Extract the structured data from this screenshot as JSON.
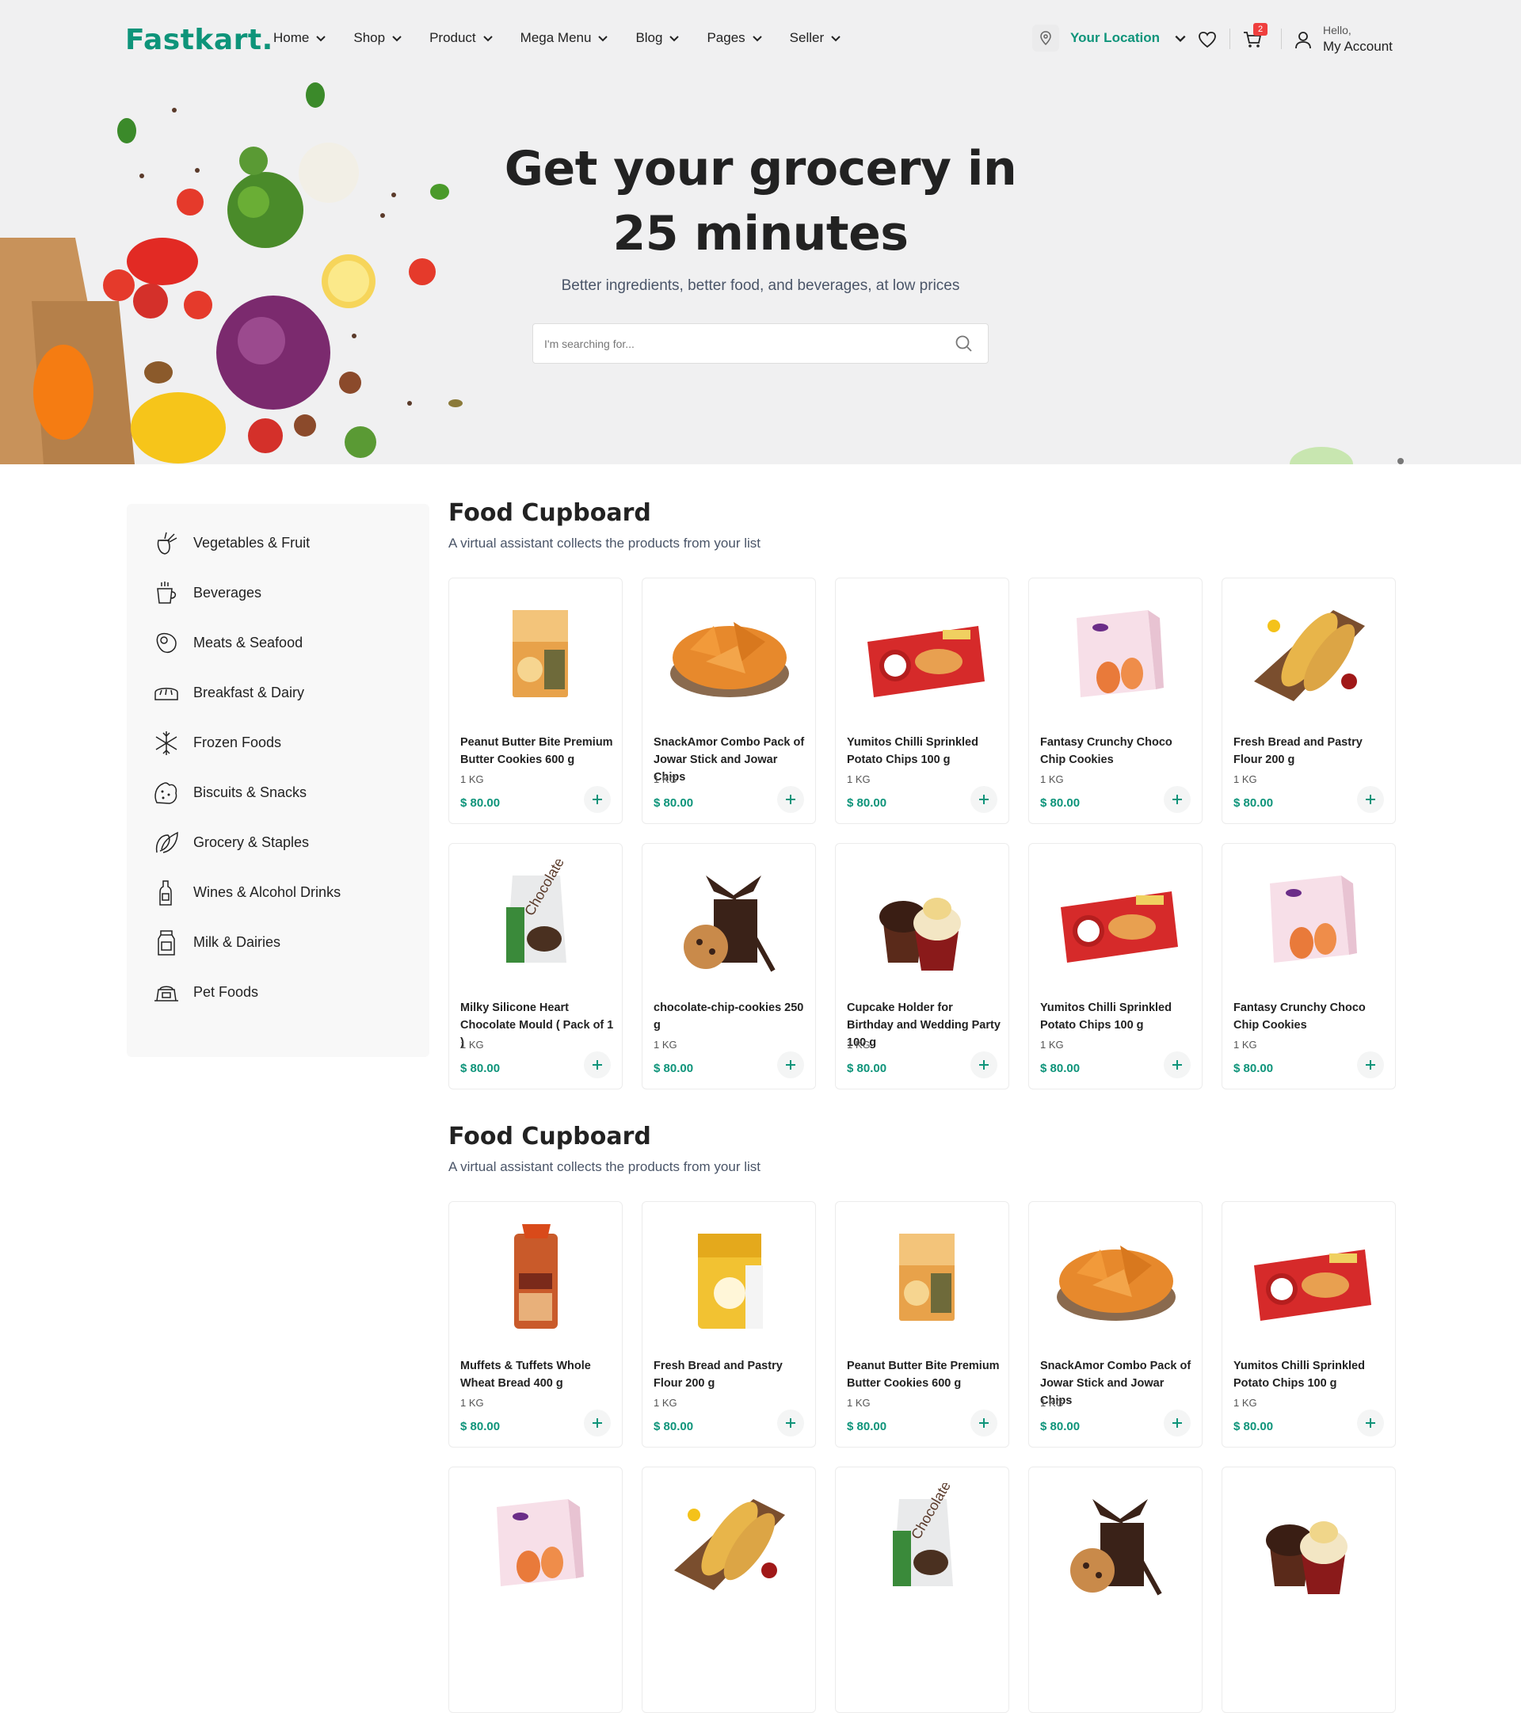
{
  "header": {
    "logo_main": "Fastkart",
    "logo_dot": ".",
    "nav": [
      "Home",
      "Shop",
      "Product",
      "Mega Menu",
      "Blog",
      "Pages",
      "Seller"
    ],
    "location_label": "Your Location",
    "cart_count": "2",
    "account_greeting": "Hello,",
    "account_label": "My Account"
  },
  "hero": {
    "title": "Get your grocery in 25 minutes",
    "subtitle": "Better ingredients, better food, and beverages, at low prices",
    "search_placeholder": "I'm searching for..."
  },
  "categories": [
    {
      "label": "Vegetables & Fruit",
      "icon": "vegetables-icon"
    },
    {
      "label": "Beverages",
      "icon": "cup-icon"
    },
    {
      "label": "Meats & Seafood",
      "icon": "meat-icon"
    },
    {
      "label": "Breakfast & Dairy",
      "icon": "bread-icon"
    },
    {
      "label": "Frozen Foods",
      "icon": "snowflake-icon"
    },
    {
      "label": "Biscuits & Snacks",
      "icon": "biscuit-icon"
    },
    {
      "label": "Grocery & Staples",
      "icon": "leaf-icon"
    },
    {
      "label": "Wines & Alcohol Drinks",
      "icon": "wine-bottle-icon"
    },
    {
      "label": "Milk & Dairies",
      "icon": "milk-icon"
    },
    {
      "label": "Pet Foods",
      "icon": "pet-food-icon"
    }
  ],
  "sections": [
    {
      "title": "Food Cupboard",
      "subtitle": "A virtual assistant collects the products from your list",
      "products": [
        {
          "name": "Peanut Butter Bite Premium Butter Cookies 600 g",
          "unit": "1 KG",
          "price": "$ 80.00",
          "image": "cookie-box"
        },
        {
          "name": "SnackAmor Combo Pack of Jowar Stick and Jowar Chips",
          "unit": "1 KG",
          "price": "$ 80.00",
          "image": "chips-bowl"
        },
        {
          "name": "Yumitos Chilli Sprinkled Potato Chips 100 g",
          "unit": "1 KG",
          "price": "$ 80.00",
          "image": "croissant-pack"
        },
        {
          "name": "Fantasy Crunchy Choco Chip Cookies",
          "unit": "1 KG",
          "price": "$ 80.00",
          "image": "pink-box"
        },
        {
          "name": "Fresh Bread and Pastry Flour 200 g",
          "unit": "1 KG",
          "price": "$ 80.00",
          "image": "baguette-board"
        },
        {
          "name": "Milky Silicone Heart Chocolate Mould ( Pack of 1 )",
          "unit": "1 KG",
          "price": "$ 80.00",
          "image": "choco-bag"
        },
        {
          "name": "chocolate-chip-cookies 250 g",
          "unit": "1 KG",
          "price": "$ 80.00",
          "image": "cookie-stack"
        },
        {
          "name": "Cupcake Holder for Birthday and Wedding Party 100 g",
          "unit": "1 KG",
          "price": "$ 80.00",
          "image": "cupcakes"
        },
        {
          "name": "Yumitos Chilli Sprinkled Potato Chips 100 g",
          "unit": "1 KG",
          "price": "$ 80.00",
          "image": "croissant-pack"
        },
        {
          "name": "Fantasy Crunchy Choco Chip Cookies",
          "unit": "1 KG",
          "price": "$ 80.00",
          "image": "pink-box"
        }
      ]
    },
    {
      "title": "Food Cupboard",
      "subtitle": "A virtual assistant collects the products from your list",
      "products": [
        {
          "name": "Muffets & Tuffets Whole Wheat Bread 400 g",
          "unit": "1 KG",
          "price": "$ 80.00",
          "image": "bread-loaf"
        },
        {
          "name": "Fresh Bread and Pastry Flour 200 g",
          "unit": "1 KG",
          "price": "$ 80.00",
          "image": "flour-bag"
        },
        {
          "name": "Peanut Butter Bite Premium Butter Cookies 600 g",
          "unit": "1 KG",
          "price": "$ 80.00",
          "image": "cookie-box"
        },
        {
          "name": "SnackAmor Combo Pack of Jowar Stick and Jowar Chips",
          "unit": "1 KG",
          "price": "$ 80.00",
          "image": "chips-bowl"
        },
        {
          "name": "Yumitos Chilli Sprinkled Potato Chips 100 g",
          "unit": "1 KG",
          "price": "$ 80.00",
          "image": "croissant-pack"
        },
        {
          "name": "",
          "unit": "",
          "price": "",
          "image": "pink-box"
        },
        {
          "name": "",
          "unit": "",
          "price": "",
          "image": "baguette-board"
        },
        {
          "name": "",
          "unit": "",
          "price": "",
          "image": "choco-bag"
        },
        {
          "name": "",
          "unit": "",
          "price": "",
          "image": "cookie-stack"
        },
        {
          "name": "",
          "unit": "",
          "price": "",
          "image": "cupcakes"
        }
      ]
    }
  ],
  "colors": {
    "accent": "#0e947a",
    "badge": "#ef3f3e",
    "hero_bg": "#f0f0f1"
  }
}
